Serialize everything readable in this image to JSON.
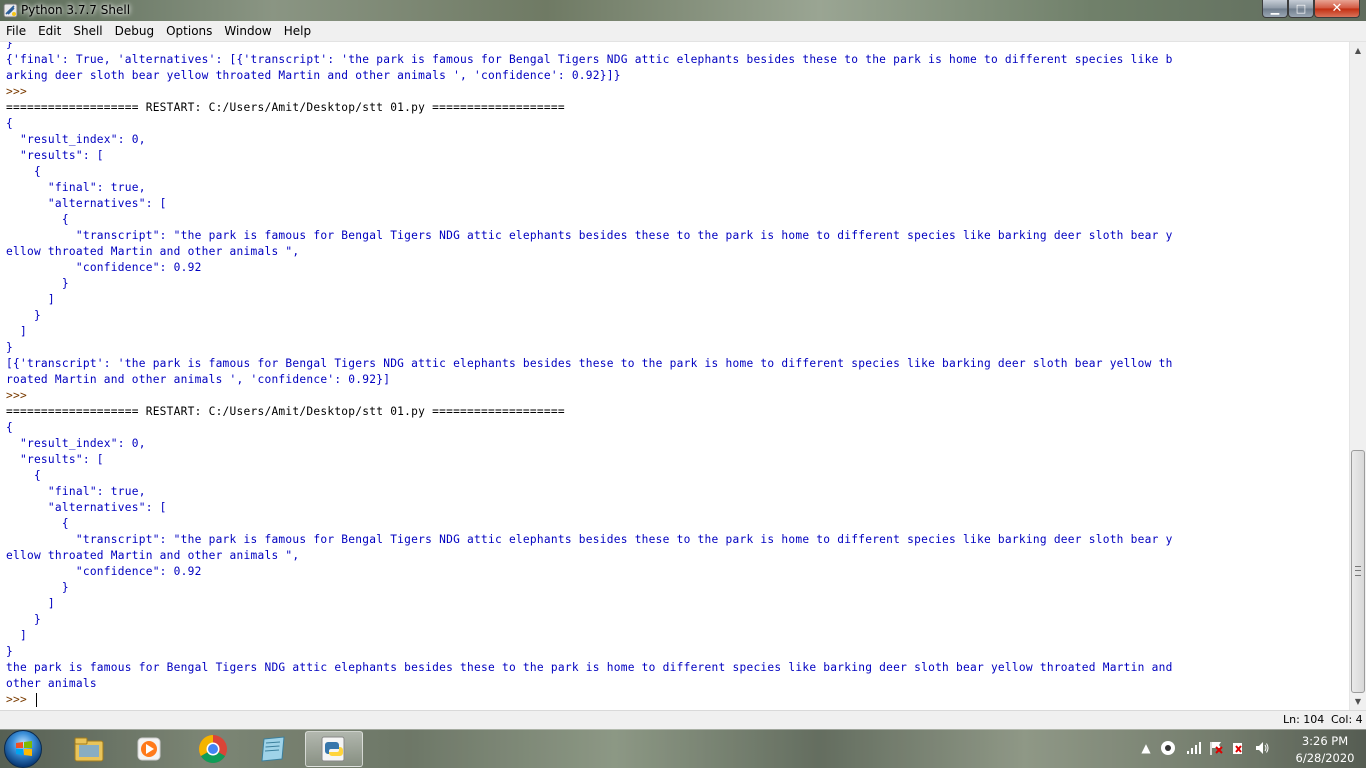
{
  "window": {
    "title": "Python 3.7.7 Shell",
    "minimize_label": "▁",
    "maximize_label": "□",
    "close_label": "✕"
  },
  "menu": {
    "items": [
      "File",
      "Edit",
      "Shell",
      "Debug",
      "Options",
      "Window",
      "Help"
    ]
  },
  "shell": {
    "lines": [
      {
        "text": "}",
        "kind": "output"
      },
      {
        "text": "{'final': True, 'alternatives': [{'transcript': 'the park is famous for Bengal Tigers NDG attic elephants besides these to the park is home to different species like b",
        "kind": "output"
      },
      {
        "text": "arking deer sloth bear yellow throated Martin and other animals ', 'confidence': 0.92}]}",
        "kind": "output"
      },
      {
        "text": ">>> ",
        "kind": "prompt"
      },
      {
        "text": "=================== RESTART: C:/Users/Amit/Desktop/stt 01.py ===================",
        "kind": "restart"
      },
      {
        "text": "{",
        "kind": "output"
      },
      {
        "text": "  \"result_index\": 0,",
        "kind": "output"
      },
      {
        "text": "  \"results\": [",
        "kind": "output"
      },
      {
        "text": "    {",
        "kind": "output"
      },
      {
        "text": "      \"final\": true,",
        "kind": "output"
      },
      {
        "text": "      \"alternatives\": [",
        "kind": "output"
      },
      {
        "text": "        {",
        "kind": "output"
      },
      {
        "text": "          \"transcript\": \"the park is famous for Bengal Tigers NDG attic elephants besides these to the park is home to different species like barking deer sloth bear y",
        "kind": "output"
      },
      {
        "text": "ellow throated Martin and other animals \",",
        "kind": "output"
      },
      {
        "text": "          \"confidence\": 0.92",
        "kind": "output"
      },
      {
        "text": "        }",
        "kind": "output"
      },
      {
        "text": "      ]",
        "kind": "output"
      },
      {
        "text": "    }",
        "kind": "output"
      },
      {
        "text": "  ]",
        "kind": "output"
      },
      {
        "text": "}",
        "kind": "output"
      },
      {
        "text": "[{'transcript': 'the park is famous for Bengal Tigers NDG attic elephants besides these to the park is home to different species like barking deer sloth bear yellow th",
        "kind": "output"
      },
      {
        "text": "roated Martin and other animals ', 'confidence': 0.92}]",
        "kind": "output"
      },
      {
        "text": ">>> ",
        "kind": "prompt"
      },
      {
        "text": "=================== RESTART: C:/Users/Amit/Desktop/stt 01.py ===================",
        "kind": "restart"
      },
      {
        "text": "{",
        "kind": "output"
      },
      {
        "text": "  \"result_index\": 0,",
        "kind": "output"
      },
      {
        "text": "  \"results\": [",
        "kind": "output"
      },
      {
        "text": "    {",
        "kind": "output"
      },
      {
        "text": "      \"final\": true,",
        "kind": "output"
      },
      {
        "text": "      \"alternatives\": [",
        "kind": "output"
      },
      {
        "text": "        {",
        "kind": "output"
      },
      {
        "text": "          \"transcript\": \"the park is famous for Bengal Tigers NDG attic elephants besides these to the park is home to different species like barking deer sloth bear y",
        "kind": "output"
      },
      {
        "text": "ellow throated Martin and other animals \",",
        "kind": "output"
      },
      {
        "text": "          \"confidence\": 0.92",
        "kind": "output"
      },
      {
        "text": "        }",
        "kind": "output"
      },
      {
        "text": "      ]",
        "kind": "output"
      },
      {
        "text": "    }",
        "kind": "output"
      },
      {
        "text": "  ]",
        "kind": "output"
      },
      {
        "text": "}",
        "kind": "output"
      },
      {
        "text": "the park is famous for Bengal Tigers NDG attic elephants besides these to the park is home to different species like barking deer sloth bear yellow throated Martin and",
        "kind": "output"
      },
      {
        "text": "other animals",
        "kind": "output"
      },
      {
        "text": ">>> ",
        "kind": "prompt",
        "caret": true
      }
    ]
  },
  "status": {
    "line": "Ln: 104",
    "col": "Col: 4"
  },
  "taskbar": {
    "apps": [
      {
        "name": "file-explorer-icon",
        "active": false
      },
      {
        "name": "media-player-icon",
        "active": false
      },
      {
        "name": "chrome-icon",
        "active": false
      },
      {
        "name": "notepad-icon",
        "active": false
      },
      {
        "name": "python-idle-icon",
        "active": true
      }
    ],
    "clock_time": "3:26 PM",
    "clock_date": "6/28/2020"
  },
  "colors": {
    "output_text": "#0000c0",
    "prompt_text": "#7a3b00",
    "restart_text": "#000000"
  }
}
